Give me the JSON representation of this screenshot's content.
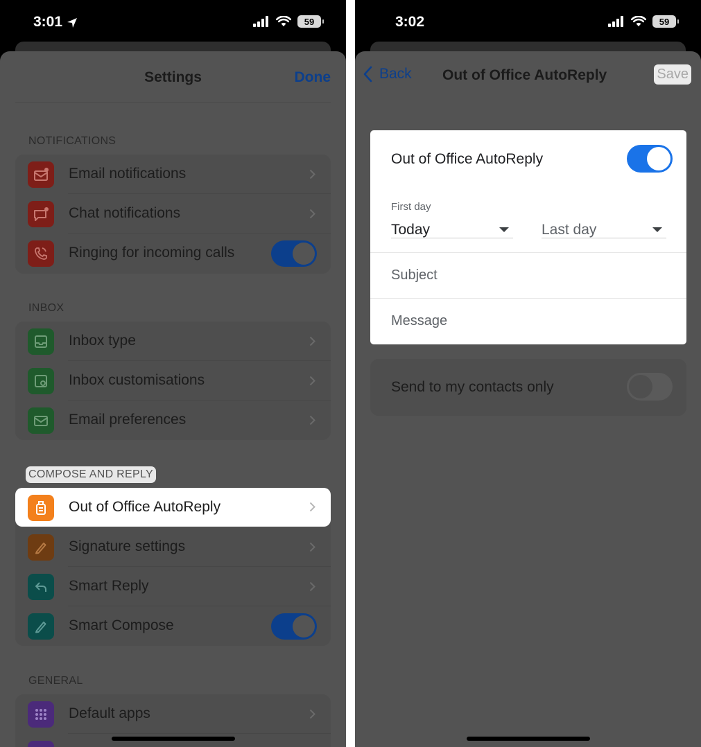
{
  "left": {
    "status": {
      "time": "3:01",
      "battery": "59"
    },
    "title": "Settings",
    "done_label": "Done",
    "sections": {
      "notifications": "NOTIFICATIONS",
      "inbox": "INBOX",
      "compose": "COMPOSE AND REPLY",
      "general": "GENERAL"
    },
    "rows": {
      "email_notifications": "Email notifications",
      "chat_notifications": "Chat notifications",
      "ringing": "Ringing for incoming calls",
      "inbox_type": "Inbox type",
      "inbox_customisations": "Inbox customisations",
      "email_preferences": "Email preferences",
      "out_of_office": "Out of Office AutoReply",
      "signature": "Signature settings",
      "smart_reply": "Smart Reply",
      "smart_compose": "Smart Compose",
      "default_apps": "Default apps"
    },
    "toggles": {
      "ringing": true,
      "smart_compose": true
    },
    "colors": {
      "red": "#7e1e18",
      "green": "#1f5a2c",
      "orange": "#f3801c",
      "brown": "#6e3c12",
      "teal": "#0b4d4a",
      "purple": "#4b2a7a",
      "blue": "#0c3f8c"
    }
  },
  "right": {
    "status": {
      "time": "3:02",
      "battery": "59"
    },
    "back_label": "Back",
    "title": "Out of Office AutoReply",
    "save_label": "Save",
    "autoreply_label": "Out of Office AutoReply",
    "autoreply_on": true,
    "first_day_label": "First day",
    "first_day_value": "Today",
    "last_day_value": "Last day",
    "subject_placeholder": "Subject",
    "message_placeholder": "Message",
    "contacts_only_label": "Send to my contacts only",
    "contacts_only_on": false,
    "accent": "#1a73e8"
  }
}
